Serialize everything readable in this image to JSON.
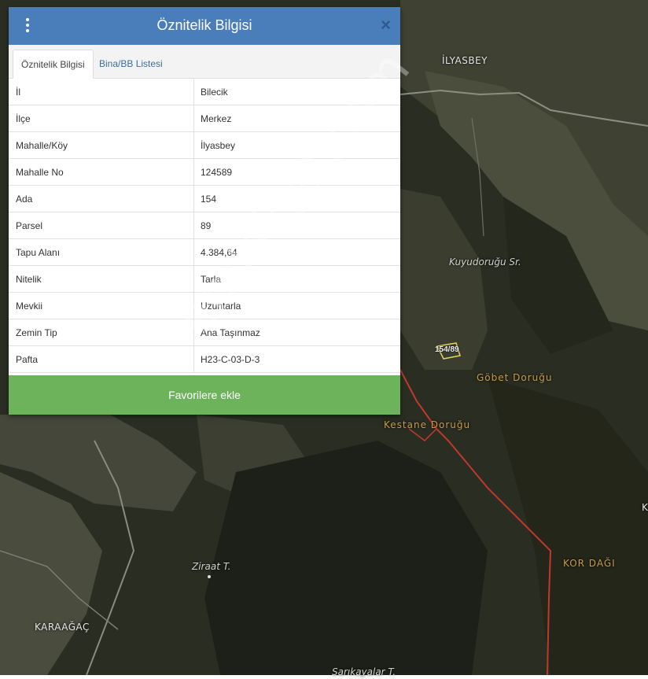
{
  "panel": {
    "title": "Öznitelik Bilgisi",
    "close_glyph": "×",
    "tabs": [
      {
        "label": "Öznitelik Bilgisi",
        "active": true
      },
      {
        "label": "Bina/BB Listesi",
        "active": false
      }
    ],
    "rows": [
      {
        "key": "İl",
        "value": "Bilecik"
      },
      {
        "key": "İlçe",
        "value": "Merkez"
      },
      {
        "key": "Mahalle/Köy",
        "value": "İlyasbey"
      },
      {
        "key": "Mahalle No",
        "value": "124589"
      },
      {
        "key": "Ada",
        "value": "154"
      },
      {
        "key": "Parsel",
        "value": "89"
      },
      {
        "key": "Tapu Alanı",
        "value": "4.384,64"
      },
      {
        "key": "Nitelik",
        "value": "Tarla"
      },
      {
        "key": "Mevkii",
        "value": "Uzuntarla"
      },
      {
        "key": "Zemin Tip",
        "value": "Ana Taşınmaz"
      },
      {
        "key": "Pafta",
        "value": "H23-C-03-D-3"
      }
    ],
    "favorite_button": "Favorilere ekle"
  },
  "map": {
    "labels": {
      "ilyasbey": "İLYASBEY",
      "kuyudorugu": "Kuyudoruğu Sr.",
      "gobet": "Göbet Doruğu",
      "kestane": "Kestane Doruğu",
      "kordagi": "KOR DAĞI",
      "ziraat": "Ziraat T.",
      "karaagac": "KARAAĞAÇ",
      "sarikayalar": "Sarıkayalar T.",
      "edge_k": "K"
    },
    "parcel_tag": "154/89",
    "colors": {
      "forest": "#22261c",
      "field": "#4a4d3a",
      "boundary": "#c0392b"
    }
  },
  "watermark": "emlakjet.com"
}
